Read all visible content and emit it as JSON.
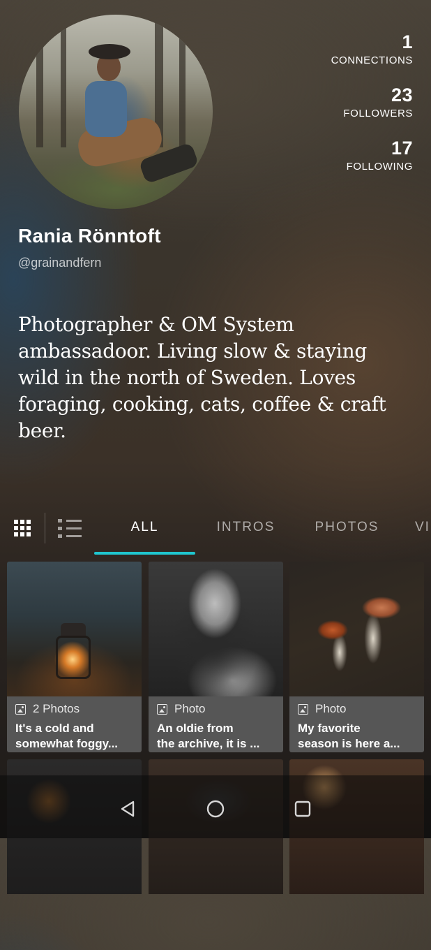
{
  "profile": {
    "name": "Rania Rönntoft",
    "handle": "@grainandfern",
    "bio": "Photographer & OM System ambassadoor. Living slow & staying wild in the north of Sweden. Loves foraging, cooking, cats, coffee & craft beer."
  },
  "stats": [
    {
      "value": "1",
      "label": "CONNECTIONS"
    },
    {
      "value": "23",
      "label": "FOLLOWERS"
    },
    {
      "value": "17",
      "label": "FOLLOWING"
    }
  ],
  "view_toggle": {
    "grid_icon": "grid-icon",
    "list_icon": "list-icon",
    "selected": "grid"
  },
  "tabs": [
    {
      "label": "ALL",
      "active": true
    },
    {
      "label": "INTROS",
      "active": false
    },
    {
      "label": "PHOTOS",
      "active": false
    },
    {
      "label": "VI",
      "active": false
    }
  ],
  "accent_color": "#1fc6cf",
  "posts": [
    {
      "type_label": "2 Photos",
      "caption": "It's a cold and\nsomewhat foggy...",
      "icon": "photo-icon"
    },
    {
      "type_label": "Photo",
      "caption": "An oldie from\nthe archive, it is ...",
      "icon": "photo-icon"
    },
    {
      "type_label": "Photo",
      "caption": "My favorite\nseason is here a...",
      "icon": "photo-icon"
    }
  ],
  "navbar": {
    "back_icon": "back-triangle-icon",
    "home_icon": "home-circle-icon",
    "recents_icon": "recents-square-icon"
  }
}
